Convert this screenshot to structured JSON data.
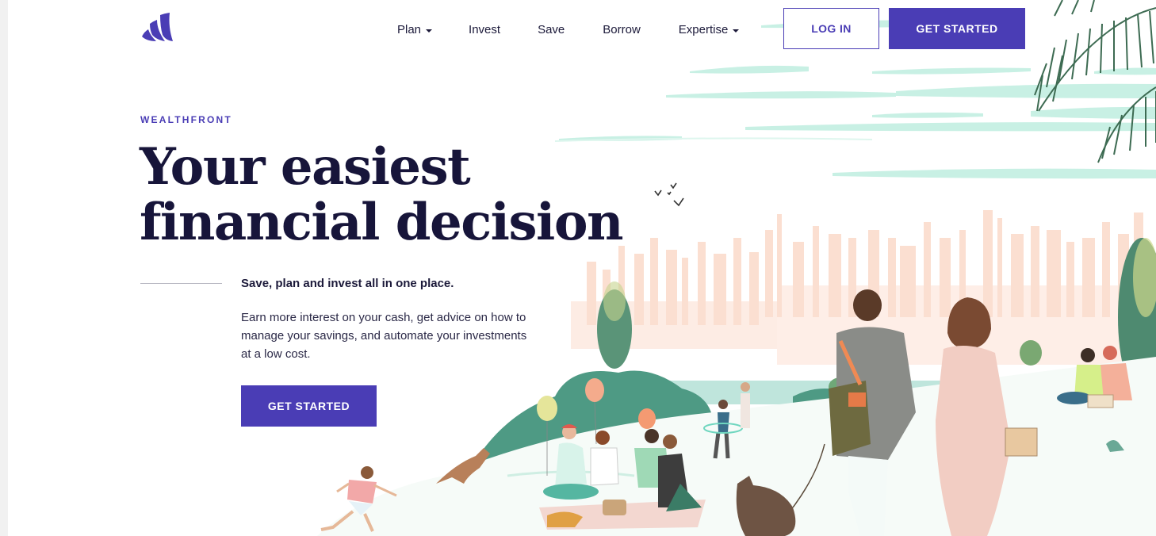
{
  "brand": {
    "name": "Wealthfront",
    "logo_icon": "wealthfront-logo-icon",
    "accent_color": "#4a3db5",
    "heading_color": "#17153a"
  },
  "nav": {
    "items": [
      {
        "label": "Plan",
        "has_dropdown": true
      },
      {
        "label": "Invest",
        "has_dropdown": false
      },
      {
        "label": "Save",
        "has_dropdown": false
      },
      {
        "label": "Borrow",
        "has_dropdown": false
      },
      {
        "label": "Expertise",
        "has_dropdown": true
      }
    ],
    "login_label": "LOG IN",
    "get_started_label": "GET STARTED"
  },
  "hero": {
    "eyebrow": "WEALTHFRONT",
    "headline_line1": "Your easiest",
    "headline_line2": "financial decision",
    "subhead": "Save, plan and invest all in one place.",
    "body_line1": "Earn more interest on your cash, get advice on how to",
    "body_line2": "manage your savings, and automate your investments",
    "body_line3": "at a low cost.",
    "cta_label": "GET STARTED",
    "illustration": "park-picnic-city-skyline-illustration"
  }
}
